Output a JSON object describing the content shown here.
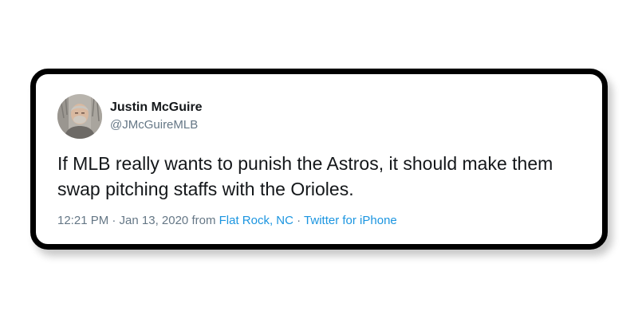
{
  "tweet": {
    "author": {
      "name": "Justin McGuire",
      "handle": "@JMcGuireMLB"
    },
    "text": "If MLB really wants to punish the Astros, it should make them\nswap pitching staffs with the Orioles.",
    "meta": {
      "time_date": "12:21 PM · Jan 13, 2020 from ",
      "location": "Flat Rock, NC",
      "separator": " · ",
      "source": "Twitter for iPhone"
    }
  },
  "colors": {
    "text": "#14171a",
    "secondary": "#657786",
    "link": "#1b95e0",
    "border": "#000000"
  }
}
